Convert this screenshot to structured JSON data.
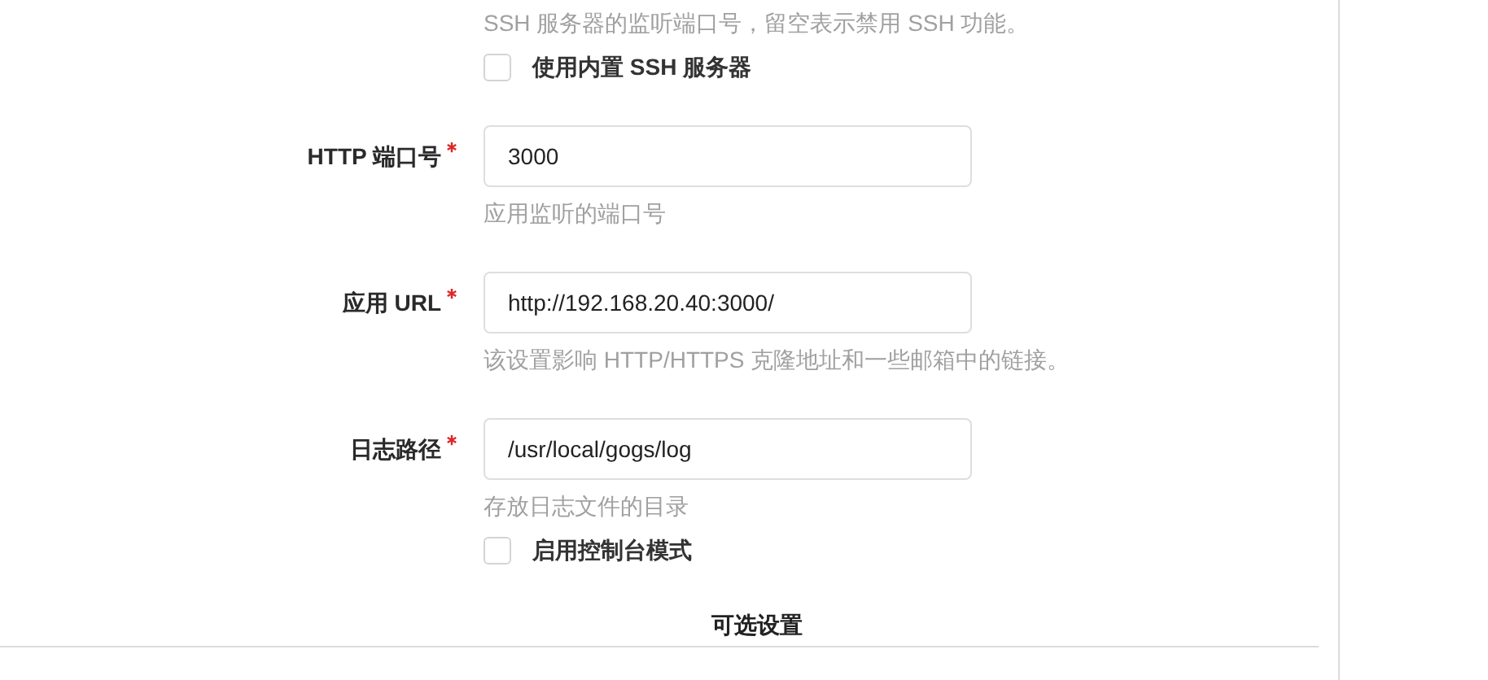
{
  "items": [
    {
      "kind": "help",
      "text": "SSH 服务器的监听端口号，留空表示禁用 SSH 功能。"
    },
    {
      "kind": "checkbox",
      "label": "使用内置 SSH 服务器",
      "checked": false
    },
    {
      "kind": "field",
      "label": "HTTP 端口号",
      "required": true,
      "value": "3000"
    },
    {
      "kind": "help",
      "text": "应用监听的端口号"
    },
    {
      "kind": "field",
      "label": "应用 URL",
      "required": true,
      "value": "http://192.168.20.40:3000/"
    },
    {
      "kind": "help",
      "text": "该设置影响 HTTP/HTTPS 克隆地址和一些邮箱中的链接。"
    },
    {
      "kind": "field",
      "label": "日志路径",
      "required": true,
      "value": "/usr/local/gogs/log"
    },
    {
      "kind": "help",
      "text": "存放日志文件的目录"
    },
    {
      "kind": "checkbox",
      "label": "启用控制台模式",
      "checked": false
    },
    {
      "kind": "section",
      "title": "可选设置"
    }
  ]
}
